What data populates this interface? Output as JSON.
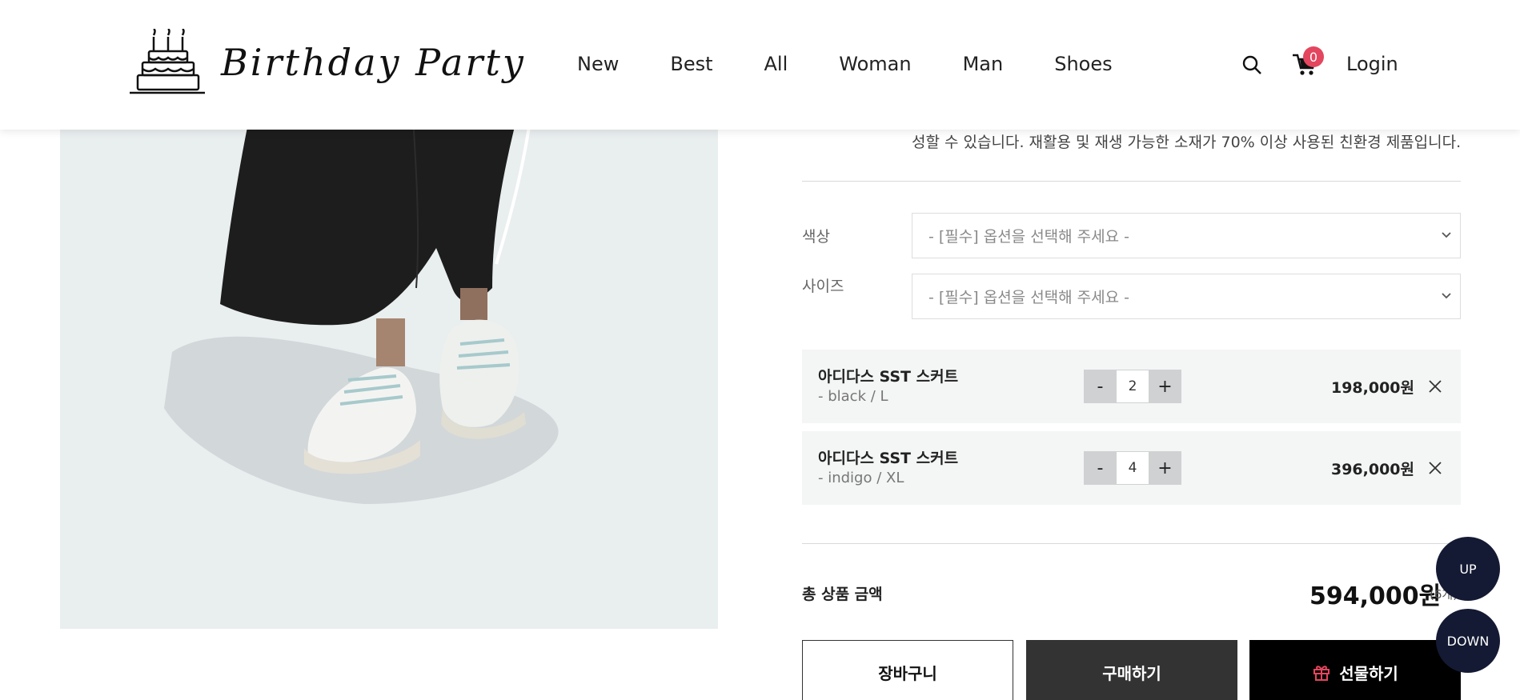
{
  "header": {
    "logo_text": "Birthday Party",
    "nav": [
      "New",
      "Best",
      "All",
      "Woman",
      "Man",
      "Shoes"
    ],
    "cart_count": "0",
    "login": "Login"
  },
  "product": {
    "description_tail": "성할 수 있습니다. 재활용 및 재생 가능한 소재가 70% 이상 사용된 친환경 제품입니다."
  },
  "options": {
    "color_label": "색상",
    "size_label": "사이즈",
    "color_placeholder": "- [필수] 옵션을 선택해 주세요 -",
    "size_placeholder": "- [필수] 옵션을 선택해 주세요 -"
  },
  "selected_items": [
    {
      "name": "아디다스 SST 스커트",
      "option": "- black / L",
      "qty": "2",
      "price": "198,000원"
    },
    {
      "name": "아디다스 SST 스커트",
      "option": "- indigo / XL",
      "qty": "4",
      "price": "396,000원"
    }
  ],
  "qty_controls": {
    "minus": "-",
    "plus": "+"
  },
  "total": {
    "label": "총 상품 금액",
    "price": "594,000원",
    "count": "(6개)"
  },
  "buttons": {
    "cart": "장바구니",
    "buy": "구매하기",
    "gift": "선물하기"
  },
  "float": {
    "up": "UP",
    "down": "DOWN"
  },
  "colors": {
    "badge": "#e3465e",
    "float_bg": "#141a33",
    "buy_bg": "#333333",
    "gift_bg": "#000000",
    "image_bg": "#e9eeef"
  }
}
